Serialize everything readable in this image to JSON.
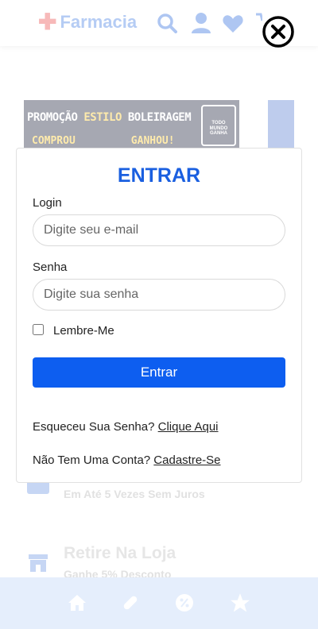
{
  "header": {
    "logo_text": "Farmacia"
  },
  "banner": {
    "line1_a": "PROMOÇÃO ",
    "line1_b": "ESTILO",
    "line1_c": " BOLEIRAGEM",
    "line2_a": "COMPROU",
    "line2_b": "GANHOU!",
    "badge": "TODO MUNDO GANHA"
  },
  "features": [
    {
      "subtitle": "Em Até 5 Vezes Sem Juros"
    },
    {
      "title": "Retire Na Loja",
      "subtitle": "Ganhe 5% Desconto"
    }
  ],
  "modal": {
    "title": "ENTRAR",
    "login_label": "Login",
    "login_placeholder": "Digite seu e-mail",
    "login_value": "",
    "password_label": "Senha",
    "password_placeholder": "Digite sua senha",
    "password_value": "",
    "remember_label": "Lembre-Me",
    "remember_checked": false,
    "submit_label": "Entrar",
    "forgot_text": "Esqueceu Sua Senha? ",
    "forgot_link": "Clique Aqui",
    "signup_text": "Não Tem Uma Conta? ",
    "signup_link": "Cadastre-Se"
  },
  "colors": {
    "accent": "#1a5fe0",
    "button": "#0d5ef0",
    "bottom_nav_bg": "#e5eefc",
    "header_icon": "#aec6f2",
    "logo_cross": "#f7b9b9"
  },
  "icons": {
    "header": [
      "search-icon",
      "user-icon",
      "heart-icon",
      "cart-icon"
    ],
    "bottom_nav": [
      "home-icon",
      "pill-icon",
      "percent-icon",
      "star-icon"
    ],
    "close": "close-icon"
  }
}
